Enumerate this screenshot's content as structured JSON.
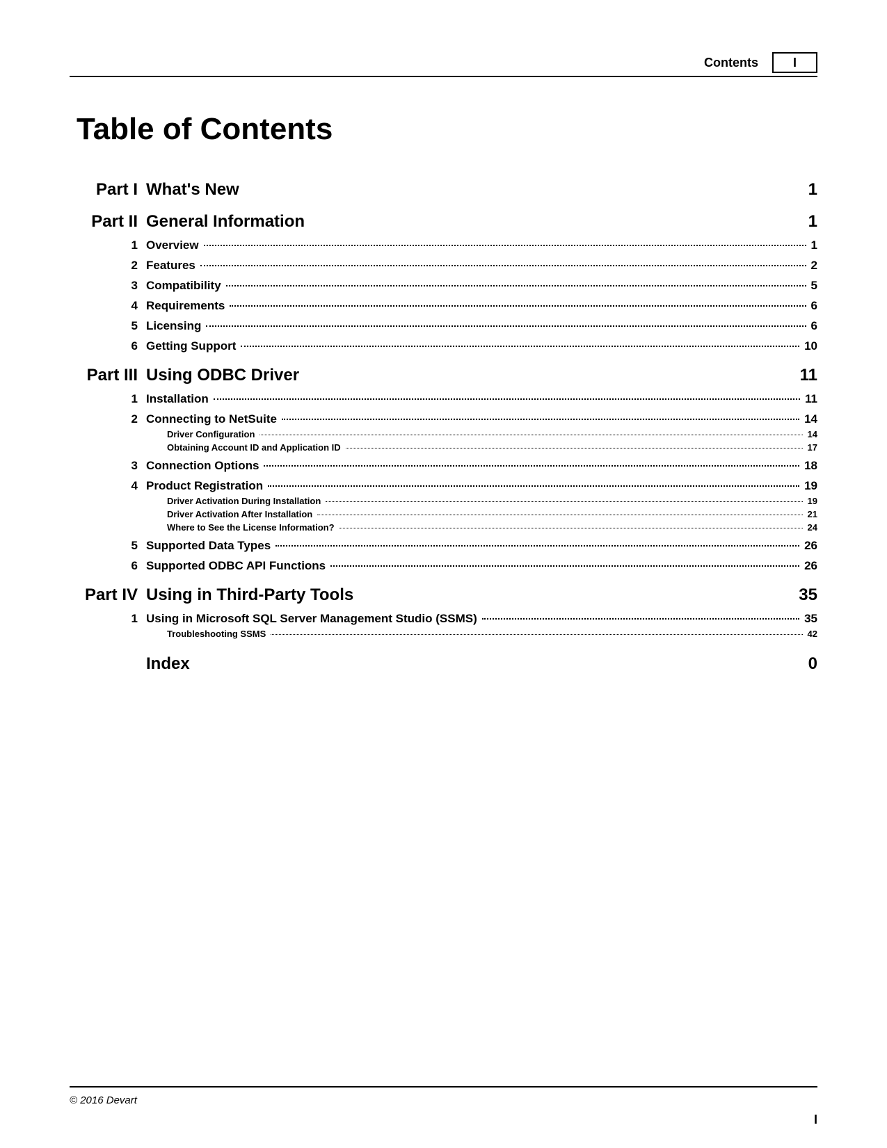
{
  "header": {
    "label": "Contents",
    "pageNumeral": "I"
  },
  "title": "Table of Contents",
  "parts": [
    {
      "num": "Part I",
      "title": "What's New",
      "page": "1",
      "sections": []
    },
    {
      "num": "Part II",
      "title": "General Information",
      "page": "1",
      "sections": [
        {
          "num": "1",
          "title": "Overview",
          "page": "1",
          "subs": []
        },
        {
          "num": "2",
          "title": "Features",
          "page": "2",
          "subs": []
        },
        {
          "num": "3",
          "title": "Compatibility",
          "page": "5",
          "subs": []
        },
        {
          "num": "4",
          "title": "Requirements",
          "page": "6",
          "subs": []
        },
        {
          "num": "5",
          "title": "Licensing",
          "page": "6",
          "subs": []
        },
        {
          "num": "6",
          "title": "Getting Support",
          "page": "10",
          "subs": []
        }
      ]
    },
    {
      "num": "Part III",
      "title": "Using ODBC Driver",
      "page": "11",
      "sections": [
        {
          "num": "1",
          "title": "Installation",
          "page": "11",
          "subs": []
        },
        {
          "num": "2",
          "title": "Connecting to NetSuite",
          "page": "14",
          "subs": [
            {
              "title": "Driver Configuration",
              "page": "14"
            },
            {
              "title": "Obtaining Account ID and Application ID",
              "page": "17"
            }
          ]
        },
        {
          "num": "3",
          "title": "Connection Options",
          "page": "18",
          "subs": []
        },
        {
          "num": "4",
          "title": "Product Registration",
          "page": "19",
          "subs": [
            {
              "title": "Driver Activation During Installation",
              "page": "19"
            },
            {
              "title": "Driver Activation After Installation",
              "page": "21"
            },
            {
              "title": "Where to See the License Information?",
              "page": "24"
            }
          ]
        },
        {
          "num": "5",
          "title": "Supported Data Types",
          "page": "26",
          "subs": []
        },
        {
          "num": "6",
          "title": "Supported ODBC API Functions",
          "page": "26",
          "subs": []
        }
      ]
    },
    {
      "num": "Part IV",
      "title": "Using in Third-Party Tools",
      "page": "35",
      "sections": [
        {
          "num": "1",
          "title": "Using in Microsoft SQL Server Management Studio (SSMS)",
          "page": "35",
          "subs": [
            {
              "title": "Troubleshooting SSMS",
              "page": "42"
            }
          ]
        }
      ]
    }
  ],
  "index": {
    "title": "Index",
    "page": "0"
  },
  "footer": {
    "copyright": "© 2016 Devart"
  },
  "cornerNumeral": "I"
}
